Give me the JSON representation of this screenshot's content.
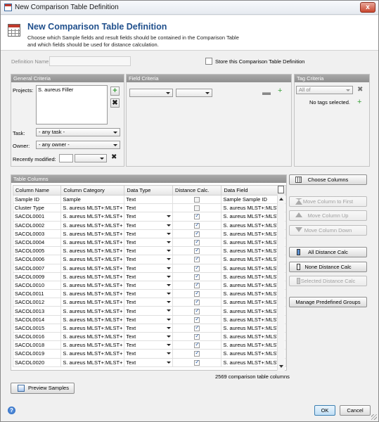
{
  "window": {
    "title": "New Comparison Table Definition",
    "close": "x"
  },
  "header": {
    "title": "New Comparison Table Definition",
    "description_line1": "Choose which Sample fields and result fields should be contained in the Comparison Table",
    "description_line2": "and which fields should be used for distance calculation."
  },
  "definition": {
    "name_label": "Definition Name:",
    "name_value": "",
    "store_label": "Store this Comparison Table Definition",
    "store_checked": false
  },
  "general": {
    "header": "General Criteria",
    "projects_label": "Projects:",
    "projects": [
      "S. aureus Filler"
    ],
    "task_label": "Task:",
    "task_value": "- any task -",
    "owner_label": "Owner:",
    "owner_value": "- any owner -",
    "recent_label": "Recently modified:",
    "recent_value": ""
  },
  "field": {
    "header": "Field Criteria",
    "combo1": "",
    "combo2": ""
  },
  "tag": {
    "header": "Tag Criteria",
    "combo": "All of",
    "empty": "No tags selected."
  },
  "table": {
    "header": "Table Columns",
    "columns": [
      "Column Name",
      "Column Category",
      "Data Type",
      "Distance Calc.",
      "Data Field"
    ],
    "rows": [
      {
        "name": "Sample ID",
        "cat": "Sample",
        "type": "Text",
        "dist": false,
        "field": "Sample Sample ID",
        "dis": true
      },
      {
        "name": "Cluster Type",
        "cat": "S. aureus MLST+:MLST+",
        "type": "Text",
        "dist": false,
        "field": "S. aureus MLST+:MLST",
        "dis": true
      },
      {
        "name": "SACOL0001",
        "cat": "S. aureus MLST+:MLST+",
        "type": "Text",
        "dist": true,
        "field": "S. aureus MLST+:MLST"
      },
      {
        "name": "SACOL0002",
        "cat": "S. aureus MLST+:MLST+",
        "type": "Text",
        "dist": true,
        "field": "S. aureus MLST+:MLST"
      },
      {
        "name": "SACOL0003",
        "cat": "S. aureus MLST+:MLST+",
        "type": "Text",
        "dist": true,
        "field": "S. aureus MLST+:MLST"
      },
      {
        "name": "SACOL0004",
        "cat": "S. aureus MLST+:MLST+",
        "type": "Text",
        "dist": true,
        "field": "S. aureus MLST+:MLST"
      },
      {
        "name": "SACOL0005",
        "cat": "S. aureus MLST+:MLST+",
        "type": "Text",
        "dist": true,
        "field": "S. aureus MLST+:MLST"
      },
      {
        "name": "SACOL0006",
        "cat": "S. aureus MLST+:MLST+",
        "type": "Text",
        "dist": true,
        "field": "S. aureus MLST+:MLST"
      },
      {
        "name": "SACOL0007",
        "cat": "S. aureus MLST+:MLST+",
        "type": "Text",
        "dist": true,
        "field": "S. aureus MLST+:MLST"
      },
      {
        "name": "SACOL0009",
        "cat": "S. aureus MLST+:MLST+",
        "type": "Text",
        "dist": true,
        "field": "S. aureus MLST+:MLST"
      },
      {
        "name": "SACOL0010",
        "cat": "S. aureus MLST+:MLST+",
        "type": "Text",
        "dist": true,
        "field": "S. aureus MLST+:MLST"
      },
      {
        "name": "SACOL0011",
        "cat": "S. aureus MLST+:MLST+",
        "type": "Text",
        "dist": true,
        "field": "S. aureus MLST+:MLST"
      },
      {
        "name": "SACOL0012",
        "cat": "S. aureus MLST+:MLST+",
        "type": "Text",
        "dist": true,
        "field": "S. aureus MLST+:MLST"
      },
      {
        "name": "SACOL0013",
        "cat": "S. aureus MLST+:MLST+",
        "type": "Text",
        "dist": true,
        "field": "S. aureus MLST+:MLST"
      },
      {
        "name": "SACOL0014",
        "cat": "S. aureus MLST+:MLST+",
        "type": "Text",
        "dist": true,
        "field": "S. aureus MLST+:MLST"
      },
      {
        "name": "SACOL0015",
        "cat": "S. aureus MLST+:MLST+",
        "type": "Text",
        "dist": true,
        "field": "S. aureus MLST+:MLST"
      },
      {
        "name": "SACOL0016",
        "cat": "S. aureus MLST+:MLST+",
        "type": "Text",
        "dist": true,
        "field": "S. aureus MLST+:MLST"
      },
      {
        "name": "SACOL0018",
        "cat": "S. aureus MLST+:MLST+",
        "type": "Text",
        "dist": true,
        "field": "S. aureus MLST+:MLST"
      },
      {
        "name": "SACOL0019",
        "cat": "S. aureus MLST+:MLST+",
        "type": "Text",
        "dist": true,
        "field": "S. aureus MLST+:MLST"
      },
      {
        "name": "SACOL0020",
        "cat": "S. aureus MLST+:MLST+",
        "type": "Text",
        "dist": true,
        "field": "S. aureus MLST+:MLST"
      }
    ],
    "count_text": "2569 comparison table columns"
  },
  "buttons": {
    "choose": "Choose Columns",
    "move_first": "Move Column to First",
    "move_up": "Move Column Up",
    "move_down": "Move Column Down",
    "all_dist": "All Distance Calc",
    "none_dist": "None Distance Calc",
    "sel_dist": "Selected Distance Calc",
    "manage": "Manage Predefined Groups",
    "preview": "Preview Samples",
    "ok": "OK",
    "cancel": "Cancel",
    "help": "?"
  },
  "icons": {
    "plus": "+",
    "x": "✖",
    "minus": "▬"
  },
  "colors": {
    "title_blue": "#1f4f8c",
    "panel_header": "#9a9a9a",
    "plus_green": "#3aa03a"
  }
}
